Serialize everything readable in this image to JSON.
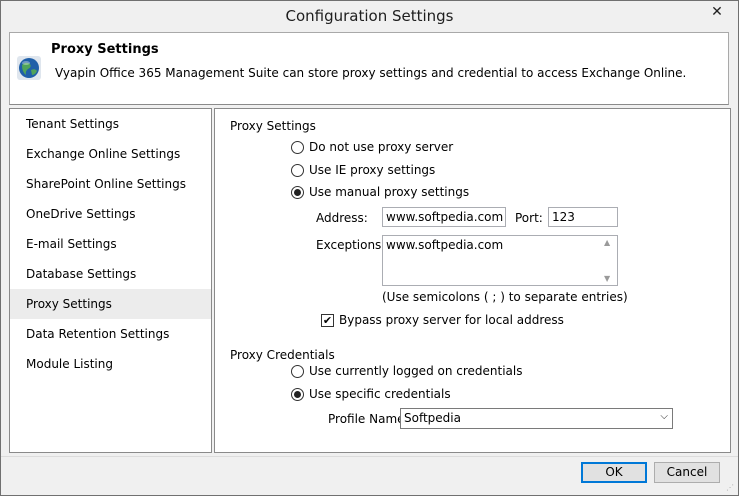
{
  "window": {
    "title": "Configuration Settings",
    "close_glyph": "✕"
  },
  "header": {
    "title": "Proxy Settings",
    "description": "Vyapin Office 365 Management Suite can store proxy settings and credential to access Exchange Online.",
    "icon": "globe-icon"
  },
  "sidebar": {
    "items": [
      {
        "label": "Tenant Settings"
      },
      {
        "label": "Exchange Online Settings"
      },
      {
        "label": "SharePoint Online Settings"
      },
      {
        "label": "OneDrive Settings"
      },
      {
        "label": "E-mail Settings"
      },
      {
        "label": "Database Settings"
      },
      {
        "label": "Proxy Settings"
      },
      {
        "label": "Data Retention Settings"
      },
      {
        "label": "Module Listing"
      }
    ],
    "selected": "Proxy Settings"
  },
  "proxy": {
    "section_label": "Proxy Settings",
    "options": [
      {
        "label": "Do not use proxy server",
        "selected": false
      },
      {
        "label": "Use IE proxy settings",
        "selected": false
      },
      {
        "label": "Use manual proxy settings",
        "selected": true
      }
    ],
    "address_label": "Address:",
    "address_value": "www.softpedia.com",
    "port_label": "Port:",
    "port_value": "123",
    "exceptions_label": "Exceptions:",
    "exceptions_value": "www.softpedia.com",
    "exceptions_hint": "(Use semicolons ( ; ) to separate entries)",
    "bypass_label": "Bypass proxy server for local address",
    "bypass_checked": true,
    "check_glyph": "✔"
  },
  "credentials": {
    "section_label": "Proxy Credentials",
    "options": [
      {
        "label": "Use currently logged on credentials",
        "selected": false
      },
      {
        "label": "Use specific credentials",
        "selected": true
      }
    ],
    "profile_label": "Profile Name:",
    "profile_value": "Softpedia"
  },
  "footer": {
    "ok_label": "OK",
    "cancel_label": "Cancel"
  }
}
